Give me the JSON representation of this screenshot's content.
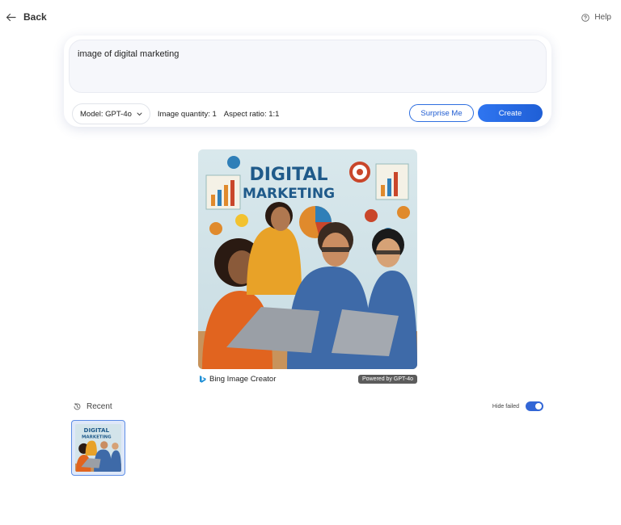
{
  "header": {
    "back_label": "Back",
    "help_label": "Help"
  },
  "prompt": {
    "value": "image of digital marketing"
  },
  "options": {
    "model_label": "Model: GPT-4o",
    "image_quantity": "Image quantity: 1",
    "aspect_ratio": "Aspect ratio: 1:1"
  },
  "buttons": {
    "surprise_label": "Surprise Me",
    "create_label": "Create"
  },
  "result": {
    "image_heading_line1": "DIGITAL",
    "image_heading_line2": "MARKETING",
    "thumb_heading_line1": "DIGITAL",
    "thumb_heading_line2": "MARKETING",
    "caption": "Bing Image Creator",
    "badge": "Powered by GPT-4o"
  },
  "recent": {
    "label": "Recent",
    "hide_failed_label": "Hide failed",
    "hide_failed_on": true
  },
  "colors": {
    "accent": "#2f6fe0",
    "create_gradient_start": "#2f75f0",
    "create_gradient_end": "#1f5fd6",
    "toggle_on": "#3266d6",
    "badge_bg": "#5c5c5c"
  },
  "icons": {
    "back": "arrow-left-icon",
    "help": "question-circle-icon",
    "model_chevron": "chevron-down-icon",
    "caption_logo": "bing-logo-icon",
    "recent": "history-icon"
  }
}
